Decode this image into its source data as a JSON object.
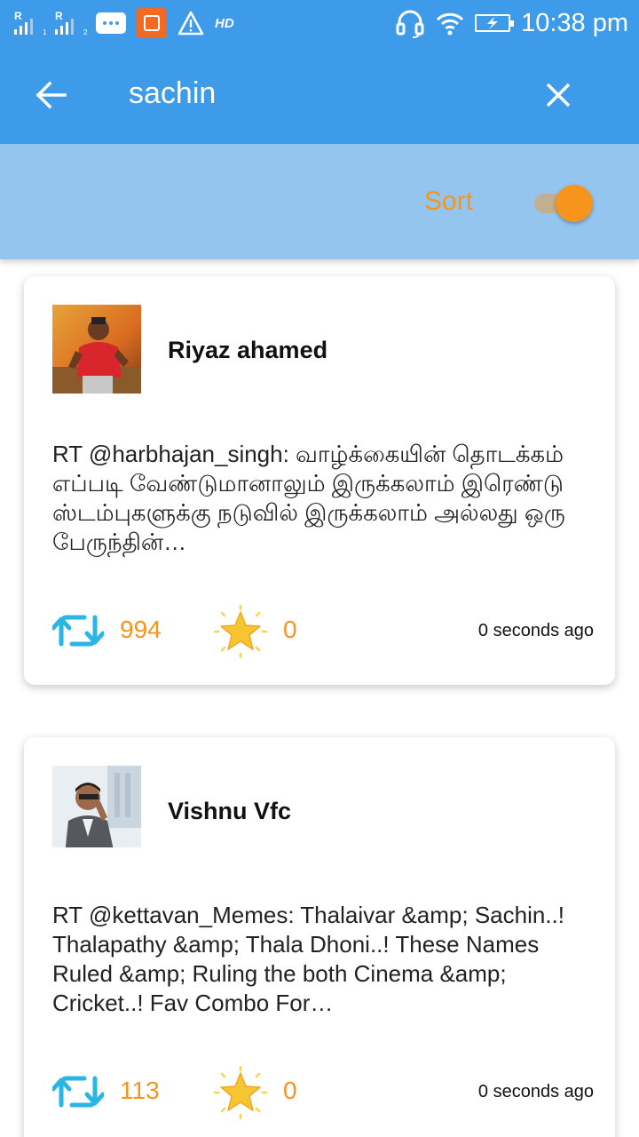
{
  "status_bar": {
    "sim1_label": "R",
    "sim1_index": "1",
    "sim2_label": "R",
    "sim2_index": "2",
    "network_label": "HD",
    "time": "10:38 pm"
  },
  "app_bar": {
    "search_query": "sachin"
  },
  "sort_bar": {
    "label": "Sort",
    "toggle_on": true,
    "accent_color": "#f7941d"
  },
  "colors": {
    "primary": "#3d9be9",
    "sort_bar_bg": "#94c5ee",
    "accent": "#f7941d",
    "retweet_icon": "#29b6e6"
  },
  "tweets": [
    {
      "user_name": "Riyaz ahamed",
      "avatar_icon": "profile-photo",
      "text": "RT @harbhajan_singh: வாழ்க்கையின் தொடக்கம் எப்படி வேண்டுமானாலும் இருக்கலாம் இரெண்டு ஸ்டம்புகளுக்கு நடுவில் இருக்கலாம் அல்லது ஒரு பேருந்தின்…",
      "retweet_count": "994",
      "favorite_count": "0",
      "time_ago": "0 seconds ago"
    },
    {
      "user_name": "Vishnu Vfc",
      "avatar_icon": "profile-photo",
      "text": "RT @kettavan_Memes: Thalaivar &amp; Sachin..! Thalapathy &amp; Thala Dhoni..! These Names Ruled &amp; Ruling the both Cinema &amp; Cricket..! Fav Combo For…",
      "retweet_count": "113",
      "favorite_count": "0",
      "time_ago": "0 seconds ago"
    }
  ]
}
